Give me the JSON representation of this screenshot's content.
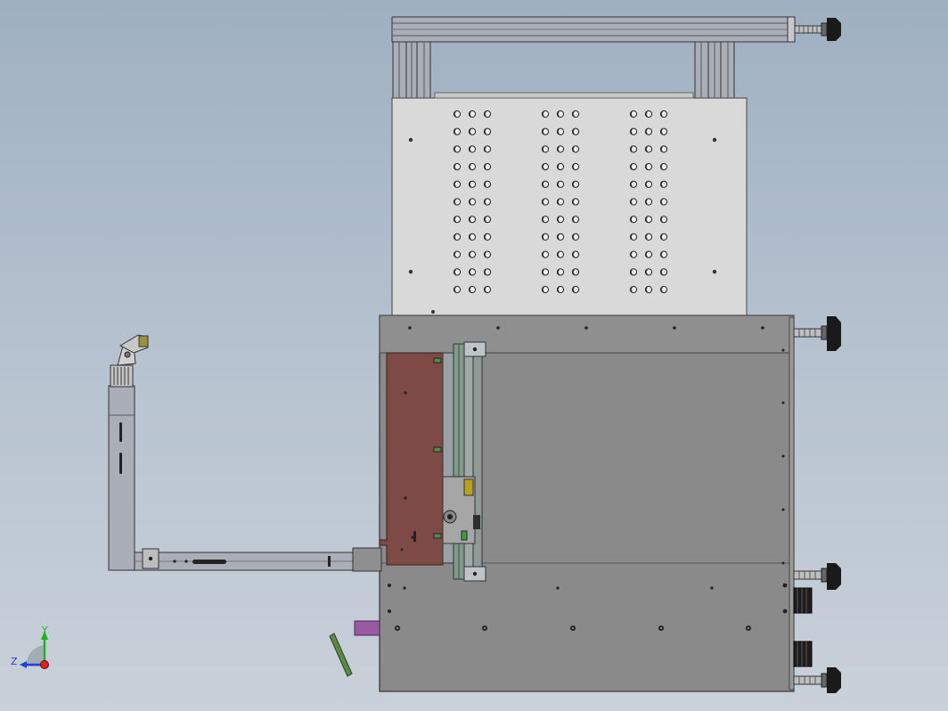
{
  "viewport": {
    "background_top": "#9fb0c2",
    "background_bottom": "#c9d1da"
  },
  "colors": {
    "dark_plate": "#8a8a8a",
    "light_plate": "#d9d9d9",
    "rail": "#a9aeb8",
    "brown_plate": "#7e4a45",
    "green_rail": "#7f9a8a",
    "purple_block": "#9a5aa0",
    "green_pin": "#5a8a4a",
    "foot": "#1a1a1a"
  },
  "triad": {
    "x_label": "",
    "y_label": "Y",
    "z_label": "Z",
    "x_color": "#e02020",
    "y_color": "#20b020",
    "z_color": "#2040e0"
  },
  "parts": {
    "top_frame_icon": "aluminum-profile-frame",
    "perforated_plate_icon": "perforated-plate",
    "base_plate_icon": "base-plate",
    "l_bracket_icon": "l-bracket-arm",
    "leveling_foot_icon": "leveling-foot",
    "slide_rail_icon": "linear-slide-rail",
    "gripper_icon": "gripper-head"
  }
}
